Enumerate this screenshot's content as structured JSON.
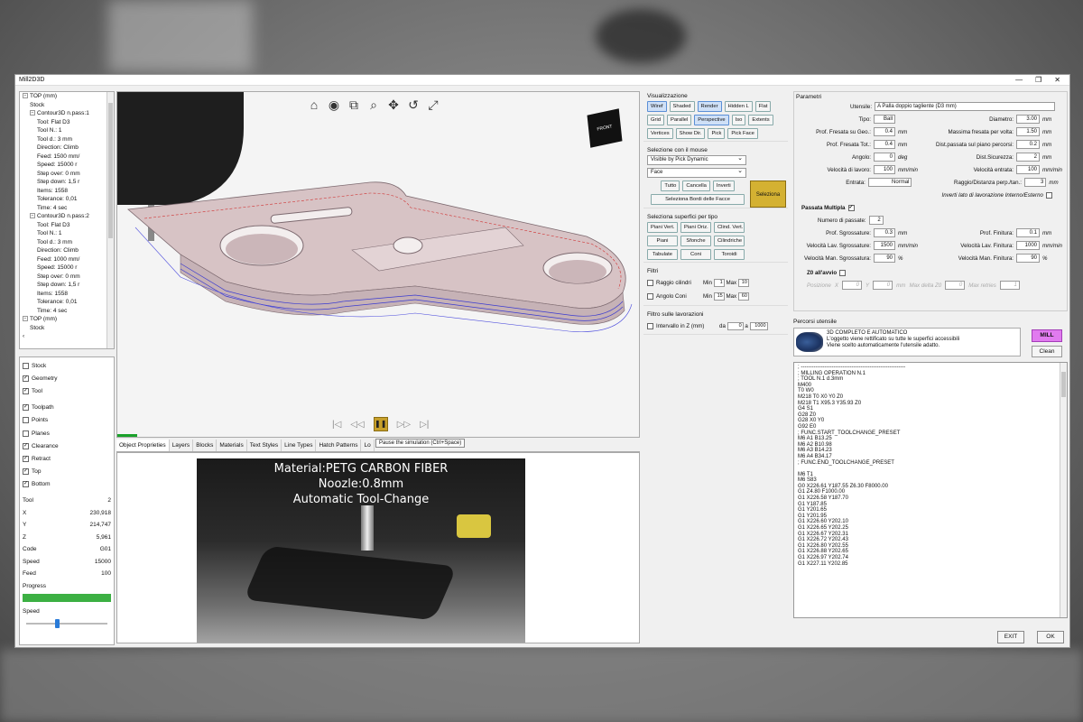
{
  "window": {
    "title": "Mill2D3D",
    "minimize": "—",
    "maximize": "❐",
    "close": "✕"
  },
  "tree": {
    "rows": [
      {
        "indent": 1,
        "toggle": "−",
        "text": "TOP (mm)"
      },
      {
        "indent": 2,
        "toggle": "",
        "text": "Stock"
      },
      {
        "indent": 2,
        "toggle": "−",
        "text": "Contour3D n.pass:1"
      },
      {
        "indent": 3,
        "toggle": "",
        "text": "Tool: Flat D3"
      },
      {
        "indent": 3,
        "toggle": "",
        "text": "Tool N.: 1"
      },
      {
        "indent": 3,
        "toggle": "",
        "text": "Tool d.: 3 mm"
      },
      {
        "indent": 3,
        "toggle": "",
        "text": "Direction: Climb"
      },
      {
        "indent": 3,
        "toggle": "",
        "text": "Feed: 1500 mm/"
      },
      {
        "indent": 3,
        "toggle": "",
        "text": "Speed: 15000 r"
      },
      {
        "indent": 3,
        "toggle": "",
        "text": "Step over: 0 mm"
      },
      {
        "indent": 3,
        "toggle": "",
        "text": "Step down: 1,5 r"
      },
      {
        "indent": 3,
        "toggle": "",
        "text": "Items: 1558"
      },
      {
        "indent": 3,
        "toggle": "",
        "text": "Tolerance: 0,01"
      },
      {
        "indent": 3,
        "toggle": "",
        "text": "Time: 4 sec"
      },
      {
        "indent": 2,
        "toggle": "−",
        "text": "Contour3D n.pass:2"
      },
      {
        "indent": 3,
        "toggle": "",
        "text": "Tool: Flat D3"
      },
      {
        "indent": 3,
        "toggle": "",
        "text": "Tool N.: 1"
      },
      {
        "indent": 3,
        "toggle": "",
        "text": "Tool d.: 3 mm"
      },
      {
        "indent": 3,
        "toggle": "",
        "text": "Direction: Climb"
      },
      {
        "indent": 3,
        "toggle": "",
        "text": "Feed: 1000 mm/"
      },
      {
        "indent": 3,
        "toggle": "",
        "text": "Speed: 15000 r"
      },
      {
        "indent": 3,
        "toggle": "",
        "text": "Step over: 0 mm"
      },
      {
        "indent": 3,
        "toggle": "",
        "text": "Step down: 1,5 r"
      },
      {
        "indent": 3,
        "toggle": "",
        "text": "Items: 1558"
      },
      {
        "indent": 3,
        "toggle": "",
        "text": "Tolerance: 0,01"
      },
      {
        "indent": 3,
        "toggle": "",
        "text": "Time: 4 sec"
      },
      {
        "indent": 1,
        "toggle": "−",
        "text": "TOP (mm)"
      },
      {
        "indent": 2,
        "toggle": "",
        "text": "Stock"
      },
      {
        "indent": 1,
        "toggle": "",
        "text": "‹"
      }
    ]
  },
  "checks1": [
    {
      "label": "Stock",
      "on": false
    },
    {
      "label": "Geometry",
      "on": true
    },
    {
      "label": "Tool",
      "on": true
    }
  ],
  "checks2": [
    {
      "label": "Toolpath",
      "on": true
    },
    {
      "label": "Points",
      "on": false
    },
    {
      "label": "Planes",
      "on": false
    },
    {
      "label": "Clearance",
      "on": true
    },
    {
      "label": "Retract",
      "on": true
    },
    {
      "label": "Top",
      "on": true
    },
    {
      "label": "Bottom",
      "on": true
    }
  ],
  "info": [
    {
      "label": "Tool",
      "value": "2"
    },
    {
      "label": "X",
      "value": "230,918"
    },
    {
      "label": "Y",
      "value": "214,747"
    },
    {
      "label": "Z",
      "value": "5,961"
    },
    {
      "label": "Code",
      "value": "G01"
    },
    {
      "label": "Speed",
      "value": "15000"
    },
    {
      "label": "Feed",
      "value": "100"
    }
  ],
  "progress_label": "Progress",
  "speed_label": "Speed",
  "viewport": {
    "tools": [
      "⌂",
      "◉",
      "⧉",
      "⌕",
      "✥",
      "↺",
      "⤢"
    ],
    "cube_label": "FRONT",
    "sim": [
      "|◁",
      "◁◁",
      "❚❚",
      "▷▷",
      "▷|"
    ],
    "tooltip": "Pause the simulation (Ctrl+Space)"
  },
  "tabs": [
    "Object Proprieties",
    "Layers",
    "Blocks",
    "Materials",
    "Text Styles",
    "Line Types",
    "Hatch Patterns",
    "Lo"
  ],
  "video": {
    "line1": "Material:PETG CARBON FIBER",
    "line2": "Noozle:0.8mm",
    "line3": "Automatic Tool-Change"
  },
  "visualizzazione": {
    "title": "Visualizzazione",
    "buttons": [
      {
        "label": "Wiref",
        "sel": true
      },
      {
        "label": "Shaded",
        "sel": false
      },
      {
        "label": "Render",
        "sel": true
      },
      {
        "label": "Hidden L",
        "sel": false
      },
      {
        "label": "Flat",
        "sel": false
      },
      {
        "label": "Grid",
        "sel": false
      },
      {
        "label": "Parallel",
        "sel": false
      },
      {
        "label": "Perspective",
        "sel": true
      },
      {
        "label": "Iso",
        "sel": false
      },
      {
        "label": "Extents",
        "sel": false
      },
      {
        "label": "Vertices",
        "sel": false
      },
      {
        "label": "Show Dir.",
        "sel": false
      },
      {
        "label": "Pick",
        "sel": false
      },
      {
        "label": "Pick Face",
        "sel": false
      }
    ]
  },
  "selezione": {
    "title": "Selezione con il mouse",
    "dd1": "Visible by Pick Dynamic",
    "dd2": "Face",
    "seleziona": "Seleziona",
    "b1": "Tutto",
    "b2": "Cancella",
    "b3": "Inverti",
    "b4": "Seleziona Bordi delle Facce"
  },
  "superfici": {
    "title": "Seleziona superfici per tipo",
    "buttons": [
      "Piani Vert.",
      "Piani Oriz.",
      "Clind. Vert.",
      "Piani",
      "Sfonche",
      "Cilindriche",
      "Tabulate",
      "Coni",
      "Toroidi"
    ]
  },
  "filtri": {
    "title": "Filtri",
    "r1": {
      "label": "Raggio cilindri",
      "min_label": "Min",
      "min": "1",
      "max_label": "Max",
      "max": "10"
    },
    "r2": {
      "label": "Angolo Coni",
      "min_label": "Min",
      "min": "15",
      "max_label": "Max",
      "max": "60"
    }
  },
  "filtro_lav": {
    "title": "Filtro sulle lavorazioni",
    "label": "Intervallo in Z (mm)",
    "da": "da",
    "da_val": "0",
    "a": "a",
    "a_val": "1000"
  },
  "parametri": {
    "title": "Parametri",
    "utensile_label": "Utensile:",
    "utensile_val": "A Palla doppio tagliente (D3 mm)",
    "rows": [
      {
        "l1": "Tipo:",
        "v1": "Ball",
        "u1": "",
        "l2": "Diametro:",
        "v2": "3.00",
        "u2": "mm"
      },
      {
        "l1": "Prof. Fresata su Geo.:",
        "v1": "0.4",
        "u1": "mm",
        "l2": "Massima fresata per volta:",
        "v2": "1.50",
        "u2": "mm"
      },
      {
        "l1": "Prof. Fresata Tot.:",
        "v1": "0.4",
        "u1": "mm",
        "l2": "Dist.passata sul piano percorsi:",
        "v2": "0.2",
        "u2": "mm"
      },
      {
        "l1": "Angolo:",
        "v1": "0",
        "u1": "deg",
        "l2": "Dist.Sicurezza:",
        "v2": "2",
        "u2": "mm"
      },
      {
        "l1": "Velocità di lavoro:",
        "v1": "100",
        "u1": "mm/min",
        "l2": "Velocità entrata:",
        "v2": "100",
        "u2": "mm/min"
      },
      {
        "l1": "Entrata:",
        "v1": "Normal",
        "u1": "",
        "l2": "Raggio/Distanza perp./tan.:",
        "v2": "3",
        "u2": "mm"
      }
    ],
    "inverti": "Inverti lato di lavorazione Interno/Esterno",
    "passata_title": "Passata Multipla",
    "num_passate_label": "Numero di passate:",
    "num_passate": "2",
    "rows2": [
      {
        "l1": "Prof. Sgrossature:",
        "v1": "0.3",
        "u1": "mm",
        "l2": "Prof. Finitura:",
        "v2": "0.1",
        "u2": "mm"
      },
      {
        "l1": "Velocità Lav. Sgrossature:",
        "v1": "1500",
        "u1": "mm/min",
        "l2": "Velocità Lav. Finitura:",
        "v2": "1000",
        "u2": "mm/min"
      },
      {
        "l1": "Velocità Man. Sgrossatura:",
        "v1": "90",
        "u1": "%",
        "l2": "Velocità Man. Finitura:",
        "v2": "90",
        "u2": "%"
      }
    ],
    "z0_label": "Z0 all'avvio",
    "posizione_label": "Posizione",
    "x_label": "X",
    "y_label": "Y",
    "pos_x": "0",
    "pos_y": "0",
    "mm": "mm",
    "max_delta_label": "Max delta Z0",
    "max_delta": "0",
    "max_retries_label": "Max retries",
    "max_retries": "1"
  },
  "percorsi": {
    "title": "Percorsi utensile",
    "line1": "3D COMPLETO E AUTOMATICO",
    "line2": "L'oggetto viene rettificato su tutte le superfici accessibili",
    "line3": "Viene scelto automaticamente l'utensile adatto.",
    "mill": "MILL",
    "clean": "Clean"
  },
  "gcode": [
    "; ----------------------------------------------------------",
    "; MILLING OPERATION N.1",
    "; TOOL N.1 d.3mm",
    "M400",
    "T0 W0",
    "M218 T0 X0 Y0 Z0",
    "M218 T1 X95.3 Y35.93 Z0",
    "G4 S1",
    "G28 Z0",
    "G28 X0 Y0",
    "G92 E0",
    "; FUNC.START_TOOLCHANGE_PRESET",
    "M6 A1 B13.25",
    "M6 A2 B10.98",
    "M6 A3 B14.23",
    "M6 A4 B34.17",
    "; FUNC.END_TOOLCHANGE_PRESET",
    "",
    "M6 T1",
    "M6 S83",
    "G0 X226.61 Y187.55 Z6.30 F8000.00",
    "G1 Z4.80 F1000.00",
    "G1 X226.58 Y187.70",
    "G1 Y187.85",
    "G1 Y201.65",
    "G1 Y201.95",
    "G1 X226.60 Y202.10",
    "G1 X226.65 Y202.25",
    "G1 X226.67 Y202.31",
    "G1 X226.72 Y202.43",
    "G1 X226.80 Y202.55",
    "G1 X226.88 Y202.65",
    "G1 X226.97 Y202.74",
    "G1 X227.11 Y202.85"
  ],
  "footer": {
    "exit": "EXIT",
    "ok": "OK"
  }
}
